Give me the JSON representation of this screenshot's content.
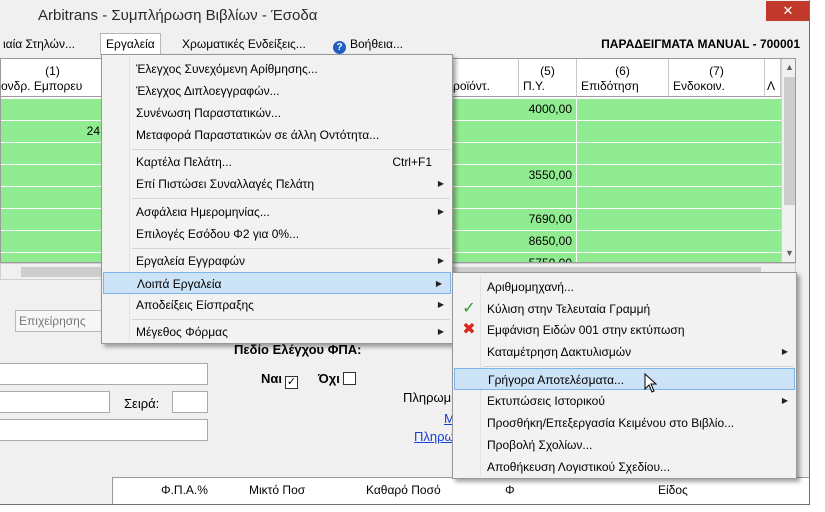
{
  "window": {
    "title": "Arbitrans - Συμπλήρωση Βιβλίων - Έσοδα",
    "close_glyph": "✕"
  },
  "menubar": {
    "items": [
      {
        "label": "ιαία Στηλών..."
      },
      {
        "label": "Εργαλεία"
      },
      {
        "label": "Χρωματικές Ενδείξεις..."
      },
      {
        "label": "Βοήθεια..."
      }
    ],
    "help_glyph": "?",
    "right_label": "ΠΑΡΑΔΕΙΓΜΑΤΑ MANUAL - 700001"
  },
  "grid": {
    "columns": [
      {
        "num": "(1)",
        "label": "ονδρ. Εμπορευ"
      },
      {
        "num": "",
        "label": "ροϊόντ."
      },
      {
        "num": "(5)",
        "label": "Π.Υ."
      },
      {
        "num": "(6)",
        "label": "Επιδότηση"
      },
      {
        "num": "(7)",
        "label": "Ενδοκοιν."
      },
      {
        "num": "",
        "label": "Λ"
      }
    ],
    "rows": [
      {
        "c1": "",
        "c5": "4000,00"
      },
      {
        "c1": "24",
        "c5": ""
      },
      {
        "c1": "",
        "c5": ""
      },
      {
        "c1": "",
        "c5": "3550,00"
      },
      {
        "c1": "",
        "c5": ""
      },
      {
        "c1": "",
        "c5": "7690,00"
      },
      {
        "c1": "",
        "c5": "8650,00"
      },
      {
        "c1": "",
        "c5": "5750,00"
      }
    ]
  },
  "form": {
    "business_tab": "Επιχείρησης",
    "field_check_label": "Πεδίο Ελέγχου ΦΠΑ:",
    "yes_label": "Ναι",
    "yes_checked": "✓",
    "no_label": "Όχι",
    "series_label": "Σειρά:",
    "payment_label": "Πληρωμ",
    "link1": "Μ",
    "link2": "Πληρωμ",
    "bottom_headers": [
      "Φ.Π.Α.%",
      "Μικτό Ποσ",
      "Καθαρό Ποσό",
      "Φ",
      "Είδος"
    ]
  },
  "tools_menu": {
    "items": [
      {
        "label": "Έλεγχος Συνεχόμενη Αρίθμησης...",
        "shortcut": "",
        "submenu": false
      },
      {
        "label": "Έλεγχος Διπλοεγγραφών...",
        "shortcut": "",
        "submenu": false
      },
      {
        "label": "Συνένωση Παραστατικών...",
        "shortcut": "",
        "submenu": false
      },
      {
        "label": "Μεταφορά Παραστατικών σε άλλη Οντότητα...",
        "shortcut": "",
        "submenu": false
      },
      {
        "label": "Καρτέλα Πελάτη...",
        "shortcut": "Ctrl+F1",
        "submenu": false
      },
      {
        "label": "Επί Πιστώσει Συναλλαγές Πελάτη",
        "shortcut": "",
        "submenu": true
      },
      {
        "label": "Ασφάλεια Ημερομηνίας...",
        "shortcut": "",
        "submenu": true
      },
      {
        "label": "Επιλογές Εσόδου Φ2 για 0%...",
        "shortcut": "",
        "submenu": false
      },
      {
        "label": "Εργαλεία Εγγραφών",
        "shortcut": "",
        "submenu": true
      },
      {
        "label": "Λοιπά Εργαλεία",
        "shortcut": "",
        "submenu": true
      },
      {
        "label": "Αποδείξεις Είσπραξης",
        "shortcut": "",
        "submenu": true
      },
      {
        "label": "Μέγεθος Φόρμας",
        "shortcut": "",
        "submenu": true
      }
    ],
    "arrow_glyph": "▶"
  },
  "other_tools_menu": {
    "items": [
      {
        "label": "Αριθμομηχανή...",
        "icon": "",
        "submenu": false
      },
      {
        "label": "Κύλιση στην Τελευταία Γραμμή",
        "icon": "✓",
        "submenu": false
      },
      {
        "label": "Εμφάνιση Ειδών 001 στην εκτύπωση",
        "icon": "✖",
        "submenu": false
      },
      {
        "label": "Καταμέτρηση Δακτυλισμών",
        "icon": "",
        "submenu": true
      },
      {
        "label": "Γρήγορα Αποτελέσματα...",
        "icon": "",
        "submenu": false
      },
      {
        "label": "Εκτυπώσεις Ιστορικού",
        "icon": "",
        "submenu": true
      },
      {
        "label": "Προσθήκη/Επεξεργασία Κειμένου στο Βιβλίο...",
        "icon": "",
        "submenu": false
      },
      {
        "label": "Προβολή Σχολίων...",
        "icon": "",
        "submenu": false
      },
      {
        "label": "Αποθήκευση Λογιστικού Σχεδίου...",
        "icon": "",
        "submenu": false
      }
    ]
  },
  "colors": {
    "row_green": "#91ec91",
    "menu_highlight": "#cbe2f7",
    "check_green": "#2a9d2a",
    "cross_red": "#d9261c",
    "link_blue": "#1a3fd6"
  }
}
